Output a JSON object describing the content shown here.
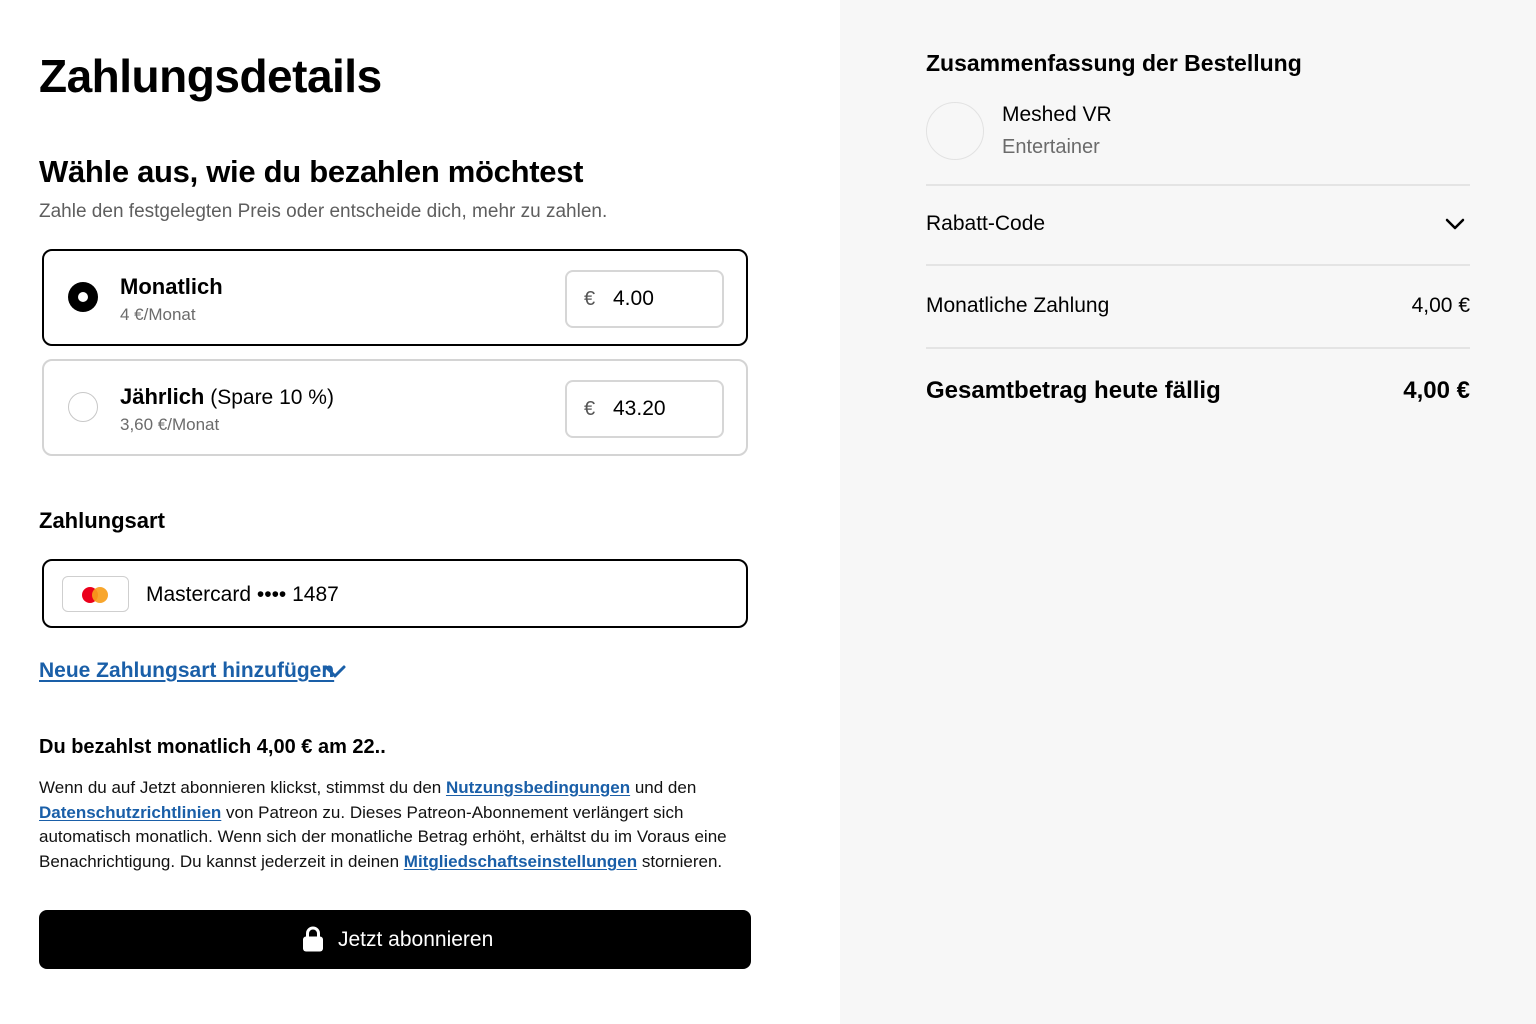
{
  "page_title": "Zahlungsdetails",
  "plan_section": {
    "title": "Wähle aus, wie du bezahlen möchtest",
    "subtitle": "Zahle den festgelegten Preis oder entscheide dich, mehr zu zahlen."
  },
  "plans": [
    {
      "name": "Monatlich",
      "extra": "",
      "rate": "4 €/Monat",
      "currency": "€",
      "amount": "4.00",
      "selected": true
    },
    {
      "name": "Jährlich",
      "extra": " (Spare 10 %)",
      "rate": "3,60 €/Monat",
      "currency": "€",
      "amount": "43.20",
      "selected": false
    }
  ],
  "payment": {
    "label": "Zahlungsart",
    "card": "Mastercard •••• 1487",
    "card_icon": "mastercard-logo",
    "add_method": "Neue Zahlungsart hinzufügen"
  },
  "billing_summary": "Du bezahlst monatlich 4,00 € am 22..",
  "legal": {
    "part1": "Wenn du auf Jetzt abonnieren klickst, stimmst du den ",
    "terms_link": "Nutzungsbedingungen",
    "part2": " und den ",
    "privacy_link": "Datenschutzrichtlinien",
    "part3": " von Patreon zu. Dieses Patreon-Abonnement verlängert sich automatisch monatlich. Wenn sich der monatliche Betrag erhöht, erhältst du im Voraus eine Benachrichtigung. Du kannst jederzeit in deinen ",
    "settings_link": "Mitgliedschaftseinstellungen",
    "part4": " stornieren."
  },
  "subscribe_button": {
    "label": "Jetzt abonnieren",
    "icon": "lock-icon"
  },
  "order_summary": {
    "title": "Zusammenfassung der Bestellung",
    "creator_name": "Meshed VR",
    "creator_type": "Entertainer",
    "discount_label": "Rabatt-Code",
    "monthly_label": "Monatliche Zahlung",
    "monthly_value": "4,00 €",
    "total_label": "Gesamtbetrag heute fällig",
    "total_value": "4,00 €"
  },
  "colors": {
    "link": "#1a5fa8",
    "button_bg": "#000000",
    "summary_bg": "#f7f7f7",
    "selected_border": "#000000",
    "unselected_border": "#d4d4d4"
  }
}
